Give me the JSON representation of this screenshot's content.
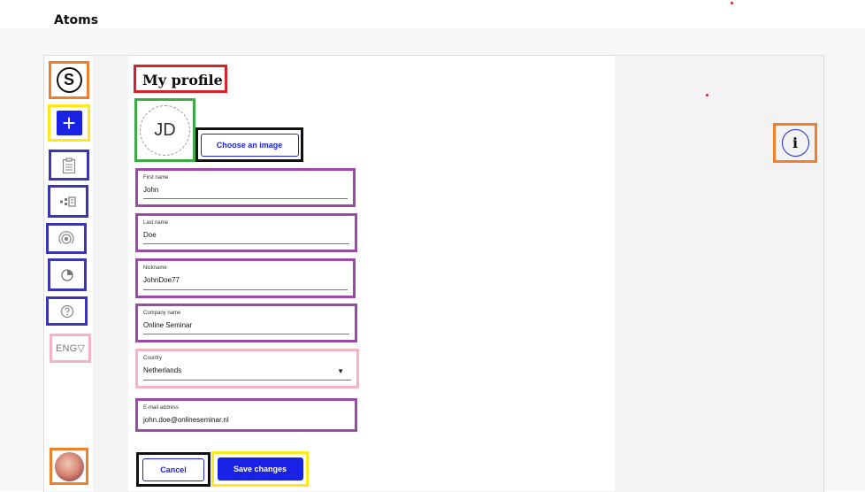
{
  "page_label": "Atoms",
  "sidebar": {
    "logo_letter": "S",
    "add_label": "+",
    "nav_items": [
      {
        "icon": "clipboard-icon"
      },
      {
        "icon": "diagram-icon"
      },
      {
        "icon": "broadcast-icon"
      },
      {
        "icon": "pie-chart-icon"
      },
      {
        "icon": "help-icon"
      }
    ],
    "language": "ENG",
    "language_chevron": "▽"
  },
  "profile": {
    "title": "My profile",
    "initials": "JD",
    "choose_image_label": "Choose an image",
    "fields": [
      {
        "label": "First name",
        "value": "John"
      },
      {
        "label": "Last name",
        "value": "Doe"
      },
      {
        "label": "Nickname",
        "value": "JohnDoe77"
      },
      {
        "label": "Company name",
        "value": "Online Seminar"
      },
      {
        "label": "Country",
        "value": "Netherlands"
      },
      {
        "label": "E-mail address",
        "value": "john.doe@onlineseminar.nl"
      }
    ],
    "country_caret": "▼",
    "cancel_label": "Cancel",
    "save_label": "Save changes"
  },
  "info_icon_glyph": "i",
  "colors": {
    "primary": "#1a22e6",
    "annotation_orange": "#f07f2c",
    "annotation_yellow": "#ffe81a",
    "annotation_blue": "#3a36b5",
    "annotation_pink": "#f8b0c4",
    "annotation_red": "#d8232a",
    "annotation_green": "#3daa45",
    "annotation_black": "#111111",
    "annotation_purple": "#9b4aaa"
  }
}
